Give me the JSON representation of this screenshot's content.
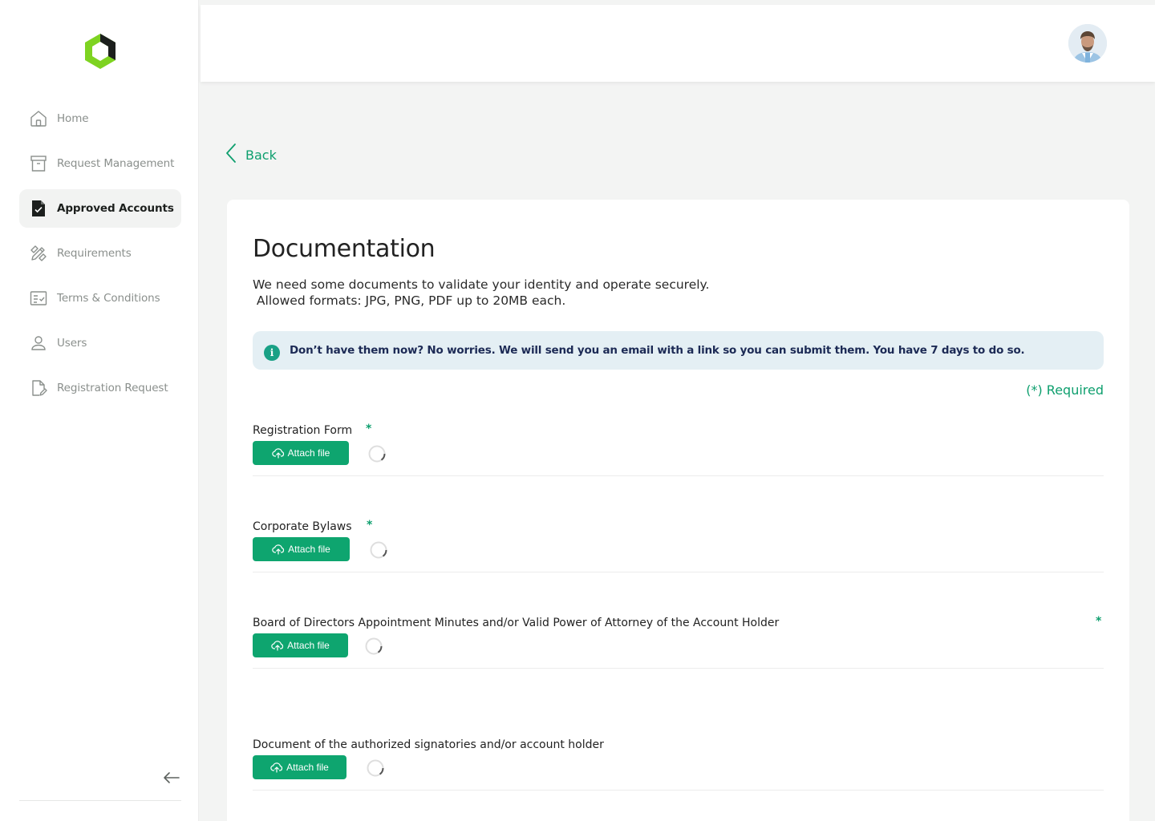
{
  "sidebar": {
    "items": [
      {
        "label": "Home",
        "icon": "home-icon"
      },
      {
        "label": "Request Management",
        "icon": "archive-box-icon"
      },
      {
        "label": "Approved Accounts",
        "icon": "document-check-icon",
        "active": true
      },
      {
        "label": "Requirements",
        "icon": "pencil-ruler-icon"
      },
      {
        "label": "Terms & Conditions",
        "icon": "checklist-icon"
      },
      {
        "label": "Users",
        "icon": "user-icon"
      },
      {
        "label": "Registration Request",
        "icon": "document-edit-icon"
      }
    ],
    "collapse_icon": "arrow-left-icon"
  },
  "back": {
    "label": "Back"
  },
  "documentation": {
    "title": "Documentation",
    "description": "We need some documents to validate your identity and operate securely.\n Allowed formats: JPG, PNG, PDF up to 20MB each.",
    "info": "Don’t have them now? No worries. We will send you an email with a link so you can submit them. You have 7 days to do so.",
    "required_note": "(*) Required",
    "documents": [
      {
        "label": "Registration Form",
        "required_mark": "*",
        "button": "Attach file"
      },
      {
        "label": "Corporate Bylaws",
        "required_mark": "*",
        "button": "Attach file"
      },
      {
        "label": "Board of Directors Appointment Minutes and/or Valid Power of Attorney of the Account Holder",
        "required_mark": "*",
        "button": "Attach file"
      },
      {
        "label": "Document of the authorized signatories and/or account holder",
        "button": "Attach file"
      }
    ]
  },
  "colors": {
    "accent": "#0ea56f",
    "logo_green": "#7ed321",
    "logo_dark": "#1c1f1d",
    "info_bg": "#e4eff4"
  }
}
